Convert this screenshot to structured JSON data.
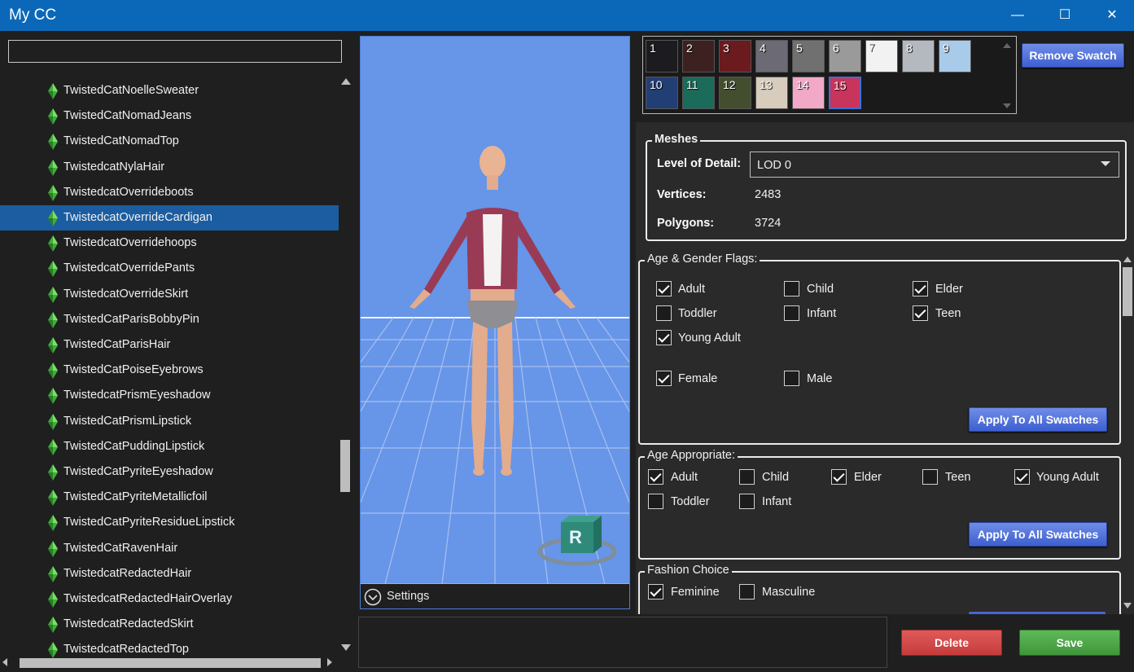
{
  "window": {
    "title": "My CC",
    "minimize": "—",
    "maximize": "☐",
    "close": "✕"
  },
  "search": {
    "value": "",
    "placeholder": ""
  },
  "tree": {
    "items": [
      {
        "label": "TwistedCatNoelleSweater"
      },
      {
        "label": "TwistedCatNomadJeans"
      },
      {
        "label": "TwistedCatNomadTop"
      },
      {
        "label": "TwistedcatNylaHair"
      },
      {
        "label": "TwistedcatOverrideboots"
      },
      {
        "label": "TwistedcatOverrideCardigan",
        "selected": true
      },
      {
        "label": "TwistedcatOverridehoops"
      },
      {
        "label": "TwistedcatOverridePants"
      },
      {
        "label": "TwistedcatOverrideSkirt"
      },
      {
        "label": "TwistedCatParisBobbyPin"
      },
      {
        "label": "TwistedCatParisHair"
      },
      {
        "label": "TwistedCatPoiseEyebrows"
      },
      {
        "label": "TwistedcatPrismEyeshadow"
      },
      {
        "label": "TwistedCatPrismLipstick"
      },
      {
        "label": "TwistedCatPuddingLipstick"
      },
      {
        "label": "TwistedCatPyriteEyeshadow"
      },
      {
        "label": "TwistedCatPyriteMetallicfoil"
      },
      {
        "label": "TwistedCatPyriteResidueLipstick"
      },
      {
        "label": "TwistedCatRavenHair"
      },
      {
        "label": "TwistedcatRedactedHair"
      },
      {
        "label": "TwistedcatRedactedHairOverlay"
      },
      {
        "label": "TwistedcatRedactedSkirt"
      },
      {
        "label": "TwistedcatRedactedTop"
      }
    ]
  },
  "viewport": {
    "settings_label": "Settings",
    "gizmo_letter": "R"
  },
  "swatches": {
    "items": [
      {
        "num": "1",
        "color": "#1c1c20"
      },
      {
        "num": "2",
        "color": "#3d2120"
      },
      {
        "num": "3",
        "color": "#6b1a1e"
      },
      {
        "num": "4",
        "color": "#6c6a74"
      },
      {
        "num": "5",
        "color": "#707070"
      },
      {
        "num": "6",
        "color": "#9a9a9a"
      },
      {
        "num": "7",
        "color": "#f2f2f2",
        "light": true
      },
      {
        "num": "8",
        "color": "#b4b9bf"
      },
      {
        "num": "9",
        "color": "#a9cbea"
      },
      {
        "num": "10",
        "color": "#223f75"
      },
      {
        "num": "11",
        "color": "#1a6b5a"
      },
      {
        "num": "12",
        "color": "#434e2f"
      },
      {
        "num": "13",
        "color": "#d8ccbc"
      },
      {
        "num": "14",
        "color": "#f2a9c8"
      },
      {
        "num": "15",
        "color": "#c8345c",
        "selected": true
      }
    ],
    "remove_label": "Remove Swatch"
  },
  "meshes": {
    "title": "Meshes",
    "lod_label": "Level of Detail:",
    "lod_value": "LOD 0",
    "vertices_label": "Vertices:",
    "vertices_value": "2483",
    "polygons_label": "Polygons:",
    "polygons_value": "3724"
  },
  "age_gender": {
    "title": "Age & Gender Flags:",
    "adult": "Adult",
    "adult_checked": true,
    "child": "Child",
    "child_checked": false,
    "elder": "Elder",
    "elder_checked": true,
    "toddler": "Toddler",
    "toddler_checked": false,
    "infant": "Infant",
    "infant_checked": false,
    "teen": "Teen",
    "teen_checked": true,
    "young_adult": "Young Adult",
    "young_adult_checked": true,
    "female": "Female",
    "female_checked": true,
    "male": "Male",
    "male_checked": false,
    "apply_label": "Apply To All Swatches"
  },
  "age_appropriate": {
    "title": "Age Appropriate:",
    "adult": "Adult",
    "child": "Child",
    "elder": "Elder",
    "teen": "Teen",
    "young_adult": "Young Adult",
    "toddler": "Toddler",
    "infant": "Infant",
    "apply_label": "Apply To All Swatches"
  },
  "fashion": {
    "title": "Fashion Choice",
    "feminine": "Feminine",
    "masculine": "Masculine"
  },
  "actions": {
    "delete_label": "Delete",
    "save_label": "Save"
  }
}
